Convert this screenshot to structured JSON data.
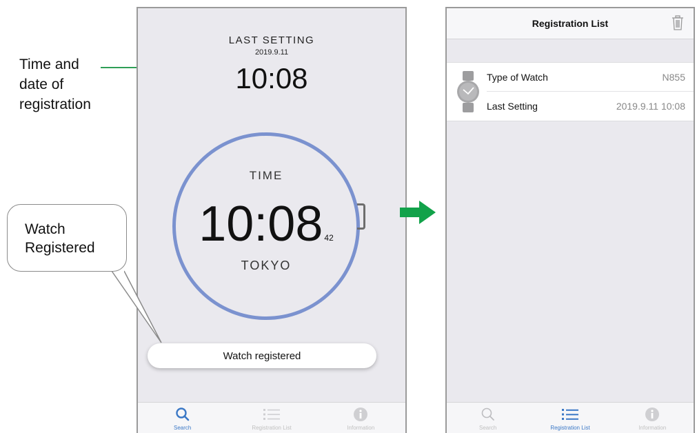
{
  "callouts": {
    "time_date_line1": "Time and",
    "time_date_line2": "date of",
    "time_date_line3": "registration",
    "watch_line1": "Watch",
    "watch_line2": "Registered"
  },
  "left_screen": {
    "last_setting_title": "LAST SETTING",
    "last_setting_date": "2019.9.11",
    "last_setting_time": "10:08",
    "time_label": "TIME",
    "time_main": "10:08",
    "time_seconds": "42",
    "city": "TOKYO",
    "registered_button": "Watch registered",
    "tabs": [
      {
        "label": "Search",
        "icon": "search-icon",
        "active": true
      },
      {
        "label": "Registration List",
        "icon": "list-icon",
        "active": false
      },
      {
        "label": "Information",
        "icon": "info-icon",
        "active": false
      }
    ]
  },
  "right_screen": {
    "title": "Registration List",
    "rows": [
      {
        "label": "Type of Watch",
        "value": "N855"
      },
      {
        "label": "Last Setting",
        "value": "2019.9.11 10:08"
      }
    ],
    "tabs": [
      {
        "label": "Search",
        "icon": "search-icon",
        "active": false
      },
      {
        "label": "Registration List",
        "icon": "list-icon",
        "active": true
      },
      {
        "label": "Information",
        "icon": "info-icon",
        "active": false
      }
    ]
  },
  "colors": {
    "accent_blue": "#3b78c6",
    "callout_green": "#2e9e56",
    "arrow_green": "#12a24a",
    "ring_blue": "#7b92cf"
  }
}
